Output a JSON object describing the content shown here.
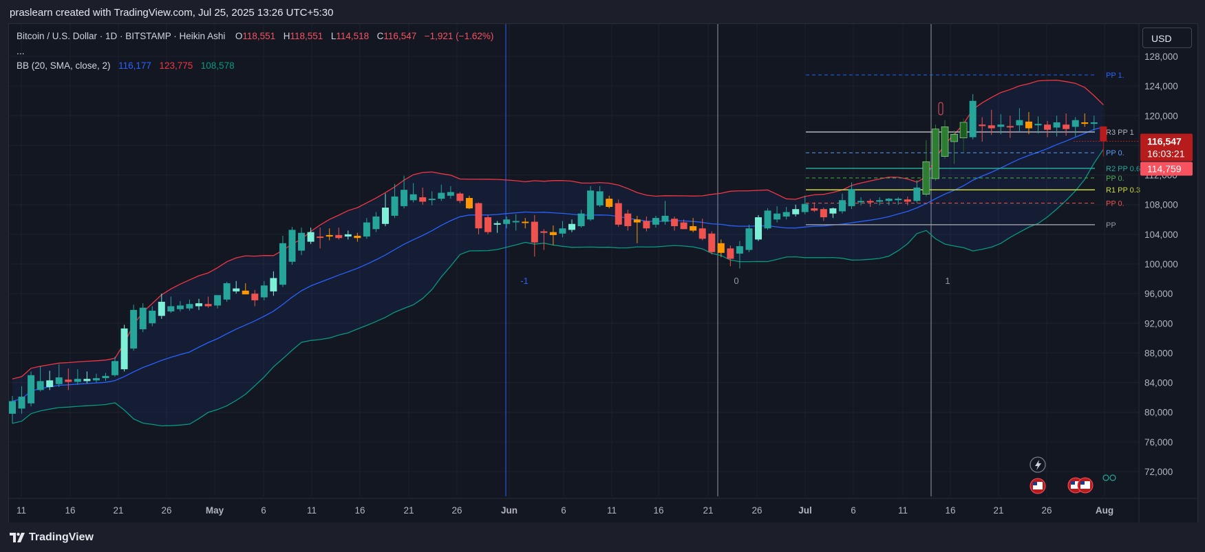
{
  "header": {
    "caption": "praslearn created with TradingView.com, Jul 25, 2025 13:26 UTC+5:30"
  },
  "legend": {
    "symbol": "Bitcoin / U.S. Dollar · 1D · BITSTAMP · Heikin Ashi",
    "o_label": "O",
    "o_value": "118,551",
    "h_label": "H",
    "h_value": "118,551",
    "l_label": "L",
    "l_value": "114,518",
    "c_label": "C",
    "c_value": "116,547",
    "change": "−1,921 (−1.62%)",
    "more": "...",
    "bb_label": "BB (20, SMA, close, 2)",
    "bb_basis": "116,177",
    "bb_upper": "123,775",
    "bb_lower": "108,578"
  },
  "currency_button": "USD",
  "footer": {
    "brand": "TradingView"
  },
  "colors": {
    "up": "#26a69a",
    "down": "#ef5350",
    "up_light": "#7ff0d8",
    "orange": "#ff9800",
    "basis": "#2962ff",
    "upper": "#f23645",
    "lower": "#089981",
    "background": "#131722"
  },
  "chart_data": {
    "type": "candlestick",
    "style": "Heikin Ashi",
    "y_axis": {
      "ticks": [
        "128,000",
        "124,000",
        "120,000",
        "116,000",
        "112,000",
        "108,000",
        "104,000",
        "100,000",
        "96,000",
        "92,000",
        "88,000",
        "84,000",
        "80,000",
        "76,000",
        "72,000"
      ],
      "range": [
        68500,
        131000
      ]
    },
    "x_axis": {
      "ticks": [
        "11",
        "16",
        "21",
        "26",
        "May",
        "6",
        "11",
        "16",
        "21",
        "26",
        "Jun",
        "6",
        "11",
        "16",
        "21",
        "26",
        "Jul",
        "6",
        "11",
        "16",
        "21",
        "26",
        "Aug"
      ],
      "bold_ticks": [
        "May",
        "Jun",
        "Jul",
        "Aug"
      ]
    },
    "price_labels": [
      {
        "text": "116,547",
        "color": "#b71c1c"
      },
      {
        "text": "16:03:21",
        "color": "#b71c1c"
      },
      {
        "text": "114,759",
        "color": "#f7525f"
      }
    ],
    "cycle_labels": [
      "-1",
      "0",
      "1"
    ],
    "pivot_labels": [
      {
        "text": "PP 1.",
        "value": 125500,
        "color": "#2962ff",
        "dashed": true
      },
      {
        "text": "R3 PP 1",
        "value": 117800,
        "color": "#b2b5be",
        "dashed": false
      },
      {
        "text": "PP 0.",
        "value": 115000,
        "color": "#5b9cf6",
        "dashed": true
      },
      {
        "text": "R2 PP 0.6",
        "value": 112900,
        "color": "#26a69a",
        "dashed": false
      },
      {
        "text": "PP 0.",
        "value": 111600,
        "color": "#4caf50",
        "dashed": true
      },
      {
        "text": "R1 PP 0.3",
        "value": 110000,
        "color": "#cddc39",
        "dashed": false
      },
      {
        "text": "PP 0.",
        "value": 108200,
        "color": "#ef5350",
        "dashed": true
      },
      {
        "text": "PP",
        "value": 105300,
        "color": "#9598a1",
        "dashed": false
      }
    ],
    "candles": [
      {
        "o": 79800,
        "h": 82200,
        "l": 78500,
        "c": 81500
      },
      {
        "o": 80500,
        "h": 83500,
        "l": 79800,
        "c": 82100
      },
      {
        "o": 81200,
        "h": 85500,
        "l": 80800,
        "c": 85000
      },
      {
        "o": 83000,
        "h": 86200,
        "l": 82800,
        "c": 84200
      },
      {
        "o": 83400,
        "h": 85600,
        "l": 83000,
        "c": 84300
      },
      {
        "o": 83800,
        "h": 86500,
        "l": 83400,
        "c": 84700
      },
      {
        "o": 84400,
        "h": 85900,
        "l": 83000,
        "c": 84100
      },
      {
        "o": 84100,
        "h": 85800,
        "l": 83700,
        "c": 84500
      },
      {
        "o": 84200,
        "h": 85500,
        "l": 83900,
        "c": 84500
      },
      {
        "o": 84300,
        "h": 85200,
        "l": 84000,
        "c": 84600
      },
      {
        "o": 84600,
        "h": 85300,
        "l": 84200,
        "c": 84900
      },
      {
        "o": 85000,
        "h": 87500,
        "l": 84800,
        "c": 86900
      },
      {
        "o": 85800,
        "h": 91800,
        "l": 85500,
        "c": 91300
      },
      {
        "o": 88600,
        "h": 94500,
        "l": 88300,
        "c": 93800
      },
      {
        "o": 91200,
        "h": 94700,
        "l": 90800,
        "c": 94100
      },
      {
        "o": 92000,
        "h": 94300,
        "l": 91600,
        "c": 93700
      },
      {
        "o": 93000,
        "h": 96000,
        "l": 92600,
        "c": 94900
      },
      {
        "o": 93600,
        "h": 95600,
        "l": 93400,
        "c": 94300
      },
      {
        "o": 93900,
        "h": 95000,
        "l": 93600,
        "c": 94400
      },
      {
        "o": 94000,
        "h": 95200,
        "l": 93700,
        "c": 94600
      },
      {
        "o": 94300,
        "h": 95300,
        "l": 93800,
        "c": 94700
      },
      {
        "o": 94600,
        "h": 95600,
        "l": 94100,
        "c": 94300
      },
      {
        "o": 94400,
        "h": 95700,
        "l": 94000,
        "c": 95800
      },
      {
        "o": 95200,
        "h": 97600,
        "l": 94900,
        "c": 97400
      },
      {
        "o": 96300,
        "h": 97700,
        "l": 96000,
        "c": 96700
      },
      {
        "o": 96400,
        "h": 97400,
        "l": 95900,
        "c": 95900
      },
      {
        "o": 96000,
        "h": 96500,
        "l": 94300,
        "c": 95100
      },
      {
        "o": 95500,
        "h": 97700,
        "l": 95100,
        "c": 97100
      },
      {
        "o": 96300,
        "h": 99000,
        "l": 95700,
        "c": 98100
      },
      {
        "o": 97200,
        "h": 103800,
        "l": 96900,
        "c": 102800
      },
      {
        "o": 100300,
        "h": 105000,
        "l": 99900,
        "c": 104600
      },
      {
        "o": 101800,
        "h": 104900,
        "l": 101200,
        "c": 104200
      },
      {
        "o": 103000,
        "h": 104900,
        "l": 102700,
        "c": 104300
      },
      {
        "o": 103700,
        "h": 104900,
        "l": 102100,
        "c": 103600
      },
      {
        "o": 103900,
        "h": 104800,
        "l": 103200,
        "c": 103700
      },
      {
        "o": 103900,
        "h": 104900,
        "l": 103300,
        "c": 103500
      },
      {
        "o": 103700,
        "h": 104500,
        "l": 103300,
        "c": 104000
      },
      {
        "o": 103800,
        "h": 104200,
        "l": 103000,
        "c": 103500
      },
      {
        "o": 103700,
        "h": 106200,
        "l": 103400,
        "c": 105600
      },
      {
        "o": 104700,
        "h": 107000,
        "l": 104300,
        "c": 106400
      },
      {
        "o": 105400,
        "h": 109500,
        "l": 105100,
        "c": 107600
      },
      {
        "o": 106500,
        "h": 110800,
        "l": 106200,
        "c": 109100
      },
      {
        "o": 107800,
        "h": 111900,
        "l": 107500,
        "c": 110000
      },
      {
        "o": 108600,
        "h": 110900,
        "l": 108300,
        "c": 109400
      },
      {
        "o": 109000,
        "h": 110300,
        "l": 108000,
        "c": 108400
      },
      {
        "o": 108700,
        "h": 109800,
        "l": 107900,
        "c": 108800
      },
      {
        "o": 108800,
        "h": 110700,
        "l": 108500,
        "c": 109600
      },
      {
        "o": 109200,
        "h": 110500,
        "l": 108800,
        "c": 109700
      },
      {
        "o": 109500,
        "h": 109700,
        "l": 108200,
        "c": 108500
      },
      {
        "o": 108900,
        "h": 109200,
        "l": 107400,
        "c": 107500
      },
      {
        "o": 108200,
        "h": 108300,
        "l": 104000,
        "c": 104800
      },
      {
        "o": 106300,
        "h": 106600,
        "l": 104000,
        "c": 104300
      },
      {
        "o": 105300,
        "h": 105800,
        "l": 104200,
        "c": 105500
      },
      {
        "o": 105400,
        "h": 106400,
        "l": 104800,
        "c": 106000
      },
      {
        "o": 105700,
        "h": 106700,
        "l": 104500,
        "c": 105800
      },
      {
        "o": 105700,
        "h": 106200,
        "l": 104800,
        "c": 105600
      },
      {
        "o": 105700,
        "h": 106600,
        "l": 101000,
        "c": 102900
      },
      {
        "o": 104400,
        "h": 104700,
        "l": 101900,
        "c": 104200
      },
      {
        "o": 104300,
        "h": 105200,
        "l": 102500,
        "c": 103900
      },
      {
        "o": 104100,
        "h": 105800,
        "l": 103600,
        "c": 104800
      },
      {
        "o": 104600,
        "h": 106000,
        "l": 104300,
        "c": 105400
      },
      {
        "o": 105100,
        "h": 107300,
        "l": 104900,
        "c": 106800
      },
      {
        "o": 106000,
        "h": 110500,
        "l": 105800,
        "c": 109900
      },
      {
        "o": 107900,
        "h": 110500,
        "l": 107700,
        "c": 109800
      },
      {
        "o": 108800,
        "h": 109200,
        "l": 107500,
        "c": 107700
      },
      {
        "o": 108200,
        "h": 108700,
        "l": 105000,
        "c": 105300
      },
      {
        "o": 106800,
        "h": 107300,
        "l": 104500,
        "c": 105100
      },
      {
        "o": 106000,
        "h": 106500,
        "l": 102800,
        "c": 105600
      },
      {
        "o": 105800,
        "h": 106400,
        "l": 104400,
        "c": 104800
      },
      {
        "o": 105300,
        "h": 106500,
        "l": 104900,
        "c": 106200
      },
      {
        "o": 105700,
        "h": 108500,
        "l": 105300,
        "c": 106500
      },
      {
        "o": 106100,
        "h": 106400,
        "l": 104500,
        "c": 105100
      },
      {
        "o": 105600,
        "h": 106000,
        "l": 104700,
        "c": 104700
      },
      {
        "o": 105100,
        "h": 106200,
        "l": 104300,
        "c": 104500
      },
      {
        "o": 104800,
        "h": 106100,
        "l": 103200,
        "c": 103400
      },
      {
        "o": 104100,
        "h": 104400,
        "l": 101300,
        "c": 101600
      },
      {
        "o": 102800,
        "h": 103300,
        "l": 100900,
        "c": 101500
      },
      {
        "o": 102100,
        "h": 102500,
        "l": 99700,
        "c": 100700
      },
      {
        "o": 101400,
        "h": 103100,
        "l": 99400,
        "c": 102400
      },
      {
        "o": 101900,
        "h": 105300,
        "l": 101600,
        "c": 104800
      },
      {
        "o": 103300,
        "h": 106600,
        "l": 103100,
        "c": 106300
      },
      {
        "o": 104800,
        "h": 107500,
        "l": 104600,
        "c": 107200
      },
      {
        "o": 106000,
        "h": 107800,
        "l": 105600,
        "c": 106800
      },
      {
        "o": 106400,
        "h": 107700,
        "l": 106000,
        "c": 107000
      },
      {
        "o": 106700,
        "h": 108000,
        "l": 106400,
        "c": 107400
      },
      {
        "o": 107000,
        "h": 109200,
        "l": 106700,
        "c": 108100
      },
      {
        "o": 107500,
        "h": 108300,
        "l": 107000,
        "c": 107200
      },
      {
        "o": 107400,
        "h": 107600,
        "l": 105800,
        "c": 106300
      },
      {
        "o": 106800,
        "h": 107600,
        "l": 106200,
        "c": 107500
      },
      {
        "o": 107100,
        "h": 109500,
        "l": 106800,
        "c": 108600
      },
      {
        "o": 107800,
        "h": 111000,
        "l": 107400,
        "c": 110100
      },
      {
        "o": 108500,
        "h": 109000,
        "l": 107900,
        "c": 108500
      },
      {
        "o": 108500,
        "h": 108800,
        "l": 107700,
        "c": 108300
      },
      {
        "o": 108400,
        "h": 109000,
        "l": 107900,
        "c": 108600
      },
      {
        "o": 108500,
        "h": 108900,
        "l": 107900,
        "c": 108800
      },
      {
        "o": 108600,
        "h": 109000,
        "l": 108000,
        "c": 108800
      },
      {
        "o": 108700,
        "h": 109100,
        "l": 107900,
        "c": 108400
      },
      {
        "o": 108500,
        "h": 111300,
        "l": 108200,
        "c": 110300
      },
      {
        "o": 109400,
        "h": 116700,
        "l": 109100,
        "c": 113800
      },
      {
        "o": 111500,
        "h": 118800,
        "l": 111200,
        "c": 118200
      },
      {
        "o": 114500,
        "h": 119400,
        "l": 114200,
        "c": 118500
      },
      {
        "o": 116500,
        "h": 118000,
        "l": 113500,
        "c": 117500
      },
      {
        "o": 117000,
        "h": 119600,
        "l": 115000,
        "c": 119100
      },
      {
        "o": 117100,
        "h": 122900,
        "l": 116800,
        "c": 122000
      },
      {
        "o": 118800,
        "h": 119800,
        "l": 116500,
        "c": 118600
      },
      {
        "o": 118700,
        "h": 120800,
        "l": 117400,
        "c": 118300
      },
      {
        "o": 118500,
        "h": 120200,
        "l": 117500,
        "c": 118800
      },
      {
        "o": 118600,
        "h": 120000,
        "l": 117000,
        "c": 118500
      },
      {
        "o": 118700,
        "h": 121000,
        "l": 117800,
        "c": 119400
      },
      {
        "o": 119200,
        "h": 120500,
        "l": 117500,
        "c": 118300
      },
      {
        "o": 118700,
        "h": 119900,
        "l": 117600,
        "c": 118900
      },
      {
        "o": 118800,
        "h": 119300,
        "l": 117100,
        "c": 118100
      },
      {
        "o": 118400,
        "h": 120000,
        "l": 117200,
        "c": 119100
      },
      {
        "o": 118800,
        "h": 120300,
        "l": 117300,
        "c": 118200
      },
      {
        "o": 118500,
        "h": 119800,
        "l": 117200,
        "c": 119400
      },
      {
        "o": 119100,
        "h": 120300,
        "l": 118500,
        "c": 118900
      },
      {
        "o": 118900,
        "h": 120000,
        "l": 118000,
        "c": 119100
      },
      {
        "o": 118551,
        "h": 118551,
        "l": 114518,
        "c": 116547
      }
    ]
  }
}
